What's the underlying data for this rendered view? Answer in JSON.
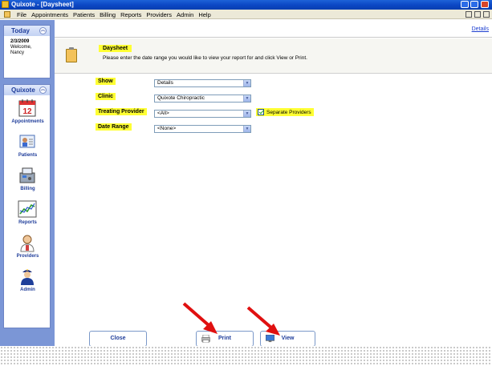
{
  "window": {
    "title": "Quixote - [Daysheet]"
  },
  "menubar": {
    "items": [
      "File",
      "Appointments",
      "Patients",
      "Billing",
      "Reports",
      "Providers",
      "Admin",
      "Help"
    ]
  },
  "today_panel": {
    "title": "Today",
    "date": "2/3/2009",
    "welcome": "Welcome,",
    "user": "Nancy"
  },
  "nav_panel": {
    "title": "Quixote",
    "items": [
      {
        "label": "Appointments",
        "icon": "calendar-icon"
      },
      {
        "label": "Patients",
        "icon": "patients-icon"
      },
      {
        "label": "Billing",
        "icon": "billing-icon"
      },
      {
        "label": "Reports",
        "icon": "reports-chart-icon"
      },
      {
        "label": "Providers",
        "icon": "provider-icon"
      },
      {
        "label": "Admin",
        "icon": "admin-officer-icon"
      }
    ]
  },
  "main": {
    "details_link": "Details",
    "report_title": "Daysheet",
    "instructions": "Please enter the date range you would like to view your report for and click View or Print.",
    "form": {
      "show_label": "Show",
      "show_value": "Details",
      "clinic_label": "Clinic",
      "clinic_value": "Quixote Chiropractic",
      "provider_label": "Treating Provider",
      "provider_value": "<All>",
      "daterange_label": "Date Range",
      "daterange_value": "<None>",
      "separate_label": "Separate Providers"
    },
    "buttons": {
      "close": "Close",
      "print": "Print",
      "view": "View"
    }
  },
  "colors": {
    "highlight": "#ffff33",
    "sidebar": "#7b96d6",
    "accent_blue": "#1f3d9a",
    "arrow": "#e01010"
  }
}
